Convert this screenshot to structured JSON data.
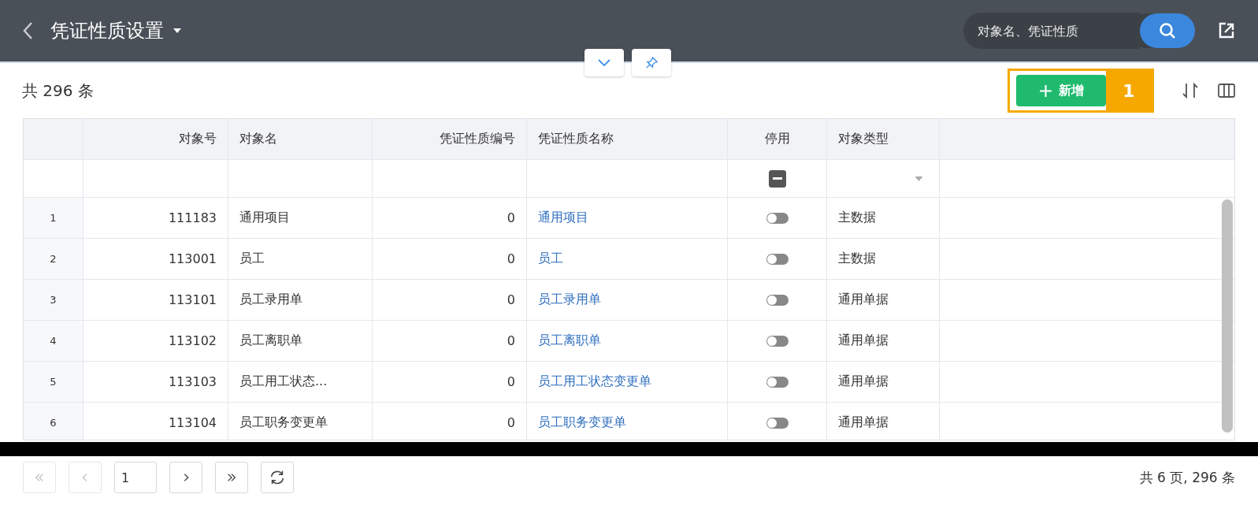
{
  "header": {
    "title": "凭证性质设置",
    "search": {
      "placeholder": "对象名、凭证性质"
    }
  },
  "toolbar": {
    "total": "共 296 条",
    "add_button": "新增",
    "callout": "1"
  },
  "table": {
    "columns": [
      "对象号",
      "对象名",
      "凭证性质编号",
      "凭证性质名称",
      "停用",
      "对象类型"
    ],
    "filter": {
      "disabled_indeterminate": true
    },
    "rows": [
      {
        "index": "1",
        "object_no": "111183",
        "object_name": "通用项目",
        "nature_no": "0",
        "nature_name": "通用项目",
        "disabled": false,
        "object_type": "主数据"
      },
      {
        "index": "2",
        "object_no": "113001",
        "object_name": "员工",
        "nature_no": "0",
        "nature_name": "员工",
        "disabled": false,
        "object_type": "主数据"
      },
      {
        "index": "3",
        "object_no": "113101",
        "object_name": "员工录用单",
        "nature_no": "0",
        "nature_name": "员工录用单",
        "disabled": false,
        "object_type": "通用单据"
      },
      {
        "index": "4",
        "object_no": "113102",
        "object_name": "员工离职单",
        "nature_no": "0",
        "nature_name": "员工离职单",
        "disabled": false,
        "object_type": "通用单据"
      },
      {
        "index": "5",
        "object_no": "113103",
        "object_name": "员工用工状态...",
        "nature_no": "0",
        "nature_name": "员工用工状态变更单",
        "disabled": false,
        "object_type": "通用单据"
      },
      {
        "index": "6",
        "object_no": "113104",
        "object_name": "员工职务变更单",
        "nature_no": "0",
        "nature_name": "员工职务变更单",
        "disabled": false,
        "object_type": "通用单据"
      }
    ]
  },
  "pagination": {
    "page": "1",
    "summary": "共 6 页, 296 条"
  }
}
